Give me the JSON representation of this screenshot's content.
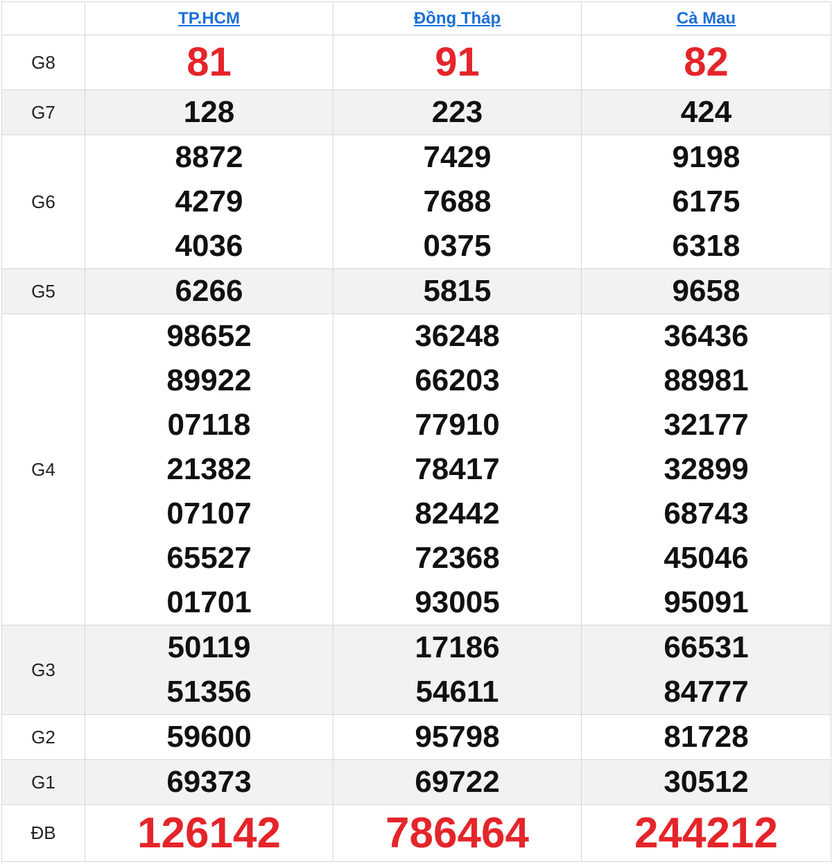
{
  "provinces": [
    "TP.HCM",
    "Đồng Tháp",
    "Cà Mau"
  ],
  "colors": {
    "accent_red": "#e4252a",
    "link_blue": "#1a6fd6",
    "row_shade": "#f2f2f2"
  },
  "prizes": {
    "g8": {
      "label": "G8",
      "values": [
        [
          "81"
        ],
        [
          "91"
        ],
        [
          "82"
        ]
      ]
    },
    "g7": {
      "label": "G7",
      "values": [
        [
          "128"
        ],
        [
          "223"
        ],
        [
          "424"
        ]
      ]
    },
    "g6": {
      "label": "G6",
      "values": [
        [
          "8872",
          "4279",
          "4036"
        ],
        [
          "7429",
          "7688",
          "0375"
        ],
        [
          "9198",
          "6175",
          "6318"
        ]
      ]
    },
    "g5": {
      "label": "G5",
      "values": [
        [
          "6266"
        ],
        [
          "5815"
        ],
        [
          "9658"
        ]
      ]
    },
    "g4": {
      "label": "G4",
      "values": [
        [
          "98652",
          "89922",
          "07118",
          "21382",
          "07107",
          "65527",
          "01701"
        ],
        [
          "36248",
          "66203",
          "77910",
          "78417",
          "82442",
          "72368",
          "93005"
        ],
        [
          "36436",
          "88981",
          "32177",
          "32899",
          "68743",
          "45046",
          "95091"
        ]
      ]
    },
    "g3": {
      "label": "G3",
      "values": [
        [
          "50119",
          "51356"
        ],
        [
          "17186",
          "54611"
        ],
        [
          "66531",
          "84777"
        ]
      ]
    },
    "g2": {
      "label": "G2",
      "values": [
        [
          "59600"
        ],
        [
          "95798"
        ],
        [
          "81728"
        ]
      ]
    },
    "g1": {
      "label": "G1",
      "values": [
        [
          "69373"
        ],
        [
          "69722"
        ],
        [
          "30512"
        ]
      ]
    },
    "db": {
      "label": "ĐB",
      "values": [
        [
          "126142"
        ],
        [
          "786464"
        ],
        [
          "244212"
        ]
      ]
    }
  }
}
